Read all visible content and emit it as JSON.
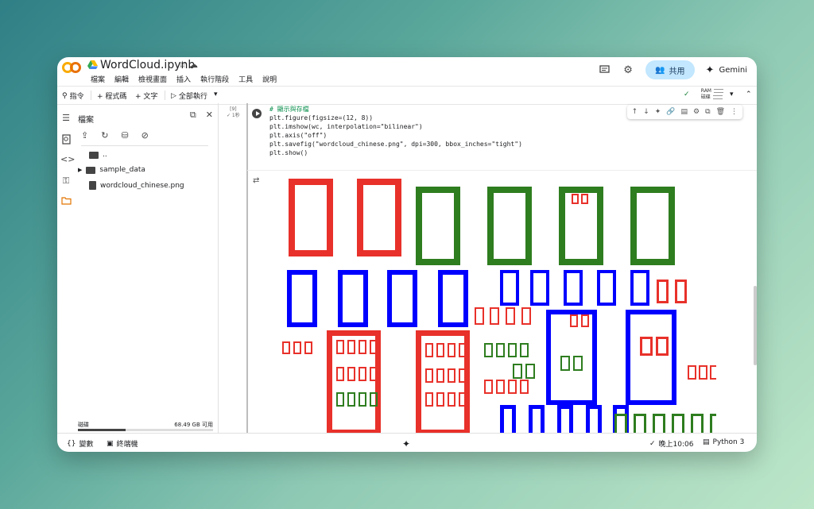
{
  "app": {
    "notebook_name": "WordCloud.ipynb",
    "menus": [
      "檔案",
      "編輯",
      "檢視畫面",
      "插入",
      "執行階段",
      "工具",
      "說明"
    ],
    "share_label": "共用",
    "gemini_label": "Gemini"
  },
  "toolbar": {
    "commands_label": "指令",
    "add_code_label": "+ 程式碼",
    "add_text_label": "+ 文字",
    "run_all_label": "全部執行",
    "ram_label": "RAM",
    "disk_label": "磁碟"
  },
  "files": {
    "title": "檔案",
    "items": [
      {
        "name": "..",
        "type": "folder"
      },
      {
        "name": "sample_data",
        "type": "folder"
      },
      {
        "name": "wordcloud_chinese.png",
        "type": "file"
      }
    ],
    "disk_label": "磁碟",
    "disk_free": "68.49 GB 可用",
    "disk_used_fraction": 0.35
  },
  "cell": {
    "exec_count": "[9]",
    "exec_time": "✓ 1秒",
    "code_lines": [
      "# 顯示與存檔",
      "plt.figure(figsize=(12, 8))",
      "plt.imshow(wc, interpolation=\"bilinear\")",
      "plt.axis(\"off\")",
      "plt.savefig(\"wordcloud_chinese.png\", dpi=300, bbox_inches=\"tight\")",
      "plt.show()"
    ]
  },
  "colors": {
    "red": "#e8312a",
    "green": "#2e7d1f",
    "blue": "#0000ff"
  },
  "status": {
    "variables_label": "變數",
    "terminal_label": "終端機",
    "time_label": "晚上10:06",
    "runtime_label": "Python 3"
  }
}
